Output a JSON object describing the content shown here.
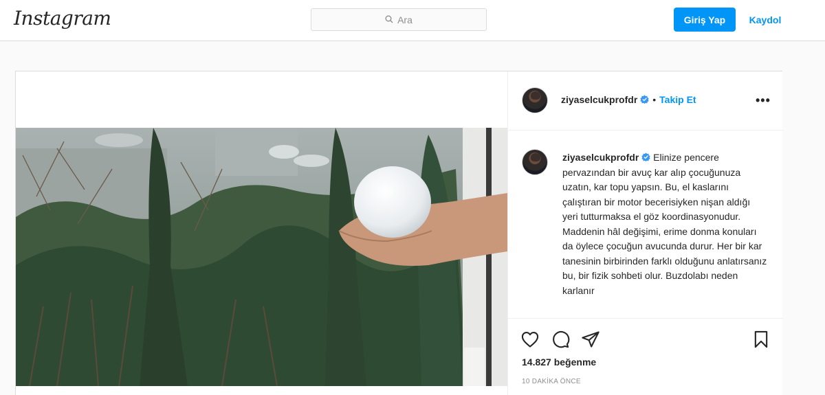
{
  "header": {
    "logo": "Instagram",
    "search_placeholder": "Ara",
    "login_label": "Giriş Yap",
    "signup_label": "Kaydol"
  },
  "post": {
    "username": "ziyaselcukprofdr",
    "separator": "•",
    "follow_label": "Takip Et",
    "more_label": "•••",
    "caption": "Elinize pencere pervazından bir avuç kar alıp çocuğunuza uzatın, kar topu yapsın. Bu, el kaslarını çalıştıran bir motor becerisiyken nişan aldığı yeri tutturmaksa el göz koordinasyonudur. Maddenin hâl değişimi, erime donma konuları da öylece çocuğun avucunda durur. Her bir kar tanesinin birbirinden farklı olduğunu anlatırsanız bu, bir fizik sohbeti olur. Buzdolabı neden karlanır",
    "likes": "14.827 beğenme",
    "timestamp": "10 DAKİKA ÖNCE"
  },
  "colors": {
    "accent": "#0095f6",
    "border": "#dbdbdb",
    "verified": "#3897f0"
  }
}
